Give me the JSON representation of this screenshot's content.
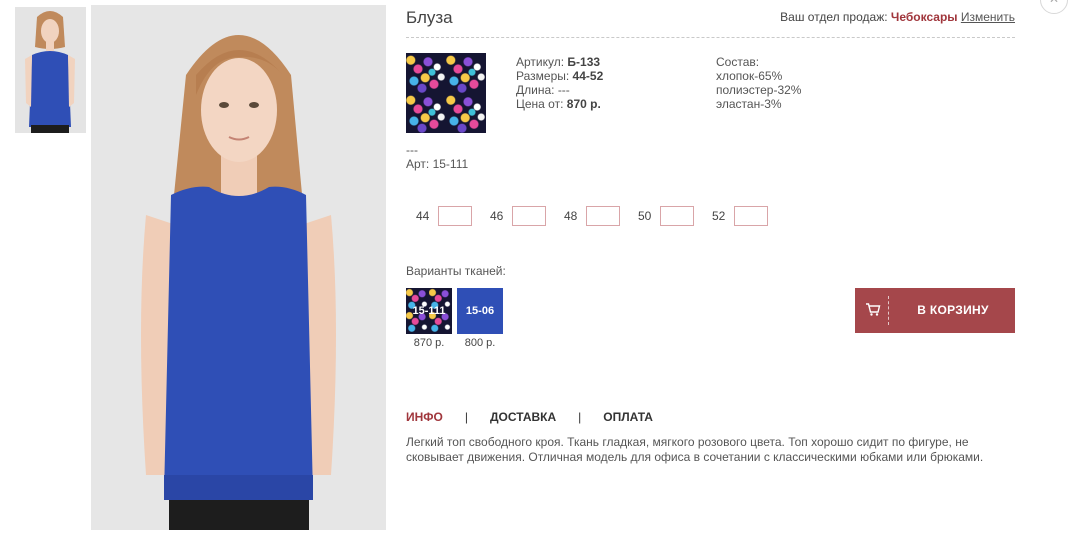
{
  "product": {
    "title": "Блуза",
    "region_label": "Ваш отдел продаж:",
    "region_city": "Чебоксары",
    "region_change": "Изменить",
    "close_glyph": "✕"
  },
  "specs": {
    "article_label": "Артикул:",
    "article_value": "Б-133",
    "sizes_label": "Размеры:",
    "sizes_value": "44-52",
    "length_label": "Длина:",
    "length_value": "---",
    "price_label": "Цена от:",
    "price_value": "870 р."
  },
  "composition": {
    "label": "Состав:",
    "items": [
      "хлопок-65%",
      "полиэстер-32%",
      "эластан-3%"
    ]
  },
  "fabric": {
    "dash": "---",
    "art": "Арт: 15-111"
  },
  "sizes": [
    {
      "label": "44",
      "value": ""
    },
    {
      "label": "46",
      "value": ""
    },
    {
      "label": "48",
      "value": ""
    },
    {
      "label": "50",
      "value": ""
    },
    {
      "label": "52",
      "value": ""
    }
  ],
  "variants": {
    "label": "Варианты тканей:",
    "items": [
      {
        "code": "15-111",
        "price": "870 р."
      },
      {
        "code": "15-06",
        "price": "800 р."
      }
    ]
  },
  "cart": {
    "label": "В КОРЗИНУ",
    "icon": "cart-icon"
  },
  "tabs": [
    "ИНФО",
    "ДОСТАВКА",
    "ОПЛАТА"
  ],
  "tab_separator": "|",
  "description": "Легкий топ свободного кроя. Ткань гладкая, мягкого розового цвета. Топ хорошо сидит по фигуре, не сковывает движения. Отличная модель для офиса в сочетании с классическими юбками или брюками.",
  "colors": {
    "accent": "#a0363c",
    "button": "#a5474b",
    "blouse": "#2f4fb6"
  }
}
